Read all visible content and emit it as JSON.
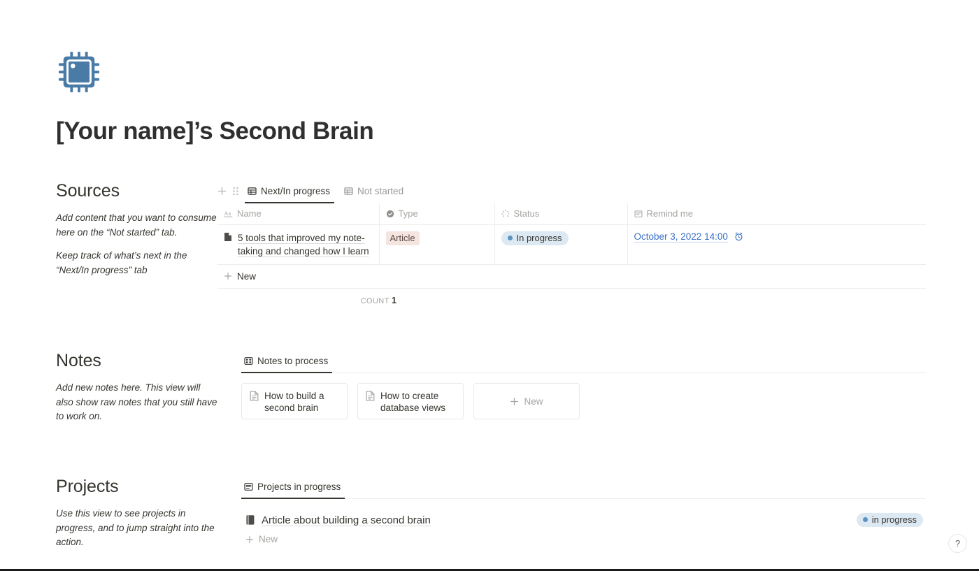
{
  "page": {
    "icon_name": "cpu-chip-icon",
    "icon_color": "#4a7ba7",
    "title": "[Your name]’s Second Brain"
  },
  "sections": {
    "sources": {
      "title": "Sources",
      "desc_1": "Add content that you want to consume here on the “Not started” tab.",
      "desc_2": "Keep track of what’s next in the “Next/In progress” tab",
      "tabs": [
        {
          "label": "Next/In progress",
          "icon": "table-view-icon",
          "active": true
        },
        {
          "label": "Not started",
          "icon": "table-view-icon",
          "active": false
        }
      ],
      "columns": [
        {
          "label": "Name",
          "icon": "title-property-icon"
        },
        {
          "label": "Type",
          "icon": "select-property-icon"
        },
        {
          "label": "Status",
          "icon": "status-property-icon"
        },
        {
          "label": "Remind me",
          "icon": "date-property-icon"
        }
      ],
      "rows": [
        {
          "name": "5 tools that improved my note-taking and changed how I learn",
          "name_icon": "page-document-icon",
          "type": "Article",
          "type_color": "#f4e5e1",
          "status": "In progress",
          "status_color": "#dce8f2",
          "remind_me": "October 3, 2022 14:00",
          "remind_icon": "alarm-clock-icon"
        }
      ],
      "new_row_label": "New",
      "count_label": "COUNT",
      "count_value": "1"
    },
    "notes": {
      "title": "Notes",
      "desc_1": "Add new notes here. This view will also show raw notes that you still have to work on.",
      "tabs": [
        {
          "label": "Notes to process",
          "icon": "gallery-view-icon",
          "active": true
        }
      ],
      "cards": [
        {
          "label": "How to build a second brain",
          "icon": "page-document-icon"
        },
        {
          "label": "How to create database views",
          "icon": "page-document-icon"
        }
      ],
      "new_card_label": "New"
    },
    "projects": {
      "title": "Projects",
      "desc_1": "Use this view to see projects in progress, and to jump straight into the action.",
      "tabs": [
        {
          "label": "Projects in progress",
          "icon": "list-view-icon",
          "active": true
        }
      ],
      "rows": [
        {
          "label": "Article about building a second brain",
          "icon": "book-dark-icon",
          "status": "in progress",
          "status_color": "#dce8f2"
        }
      ],
      "new_row_label": "New"
    }
  },
  "help": {
    "label": "?",
    "icon": "question-mark-icon"
  }
}
